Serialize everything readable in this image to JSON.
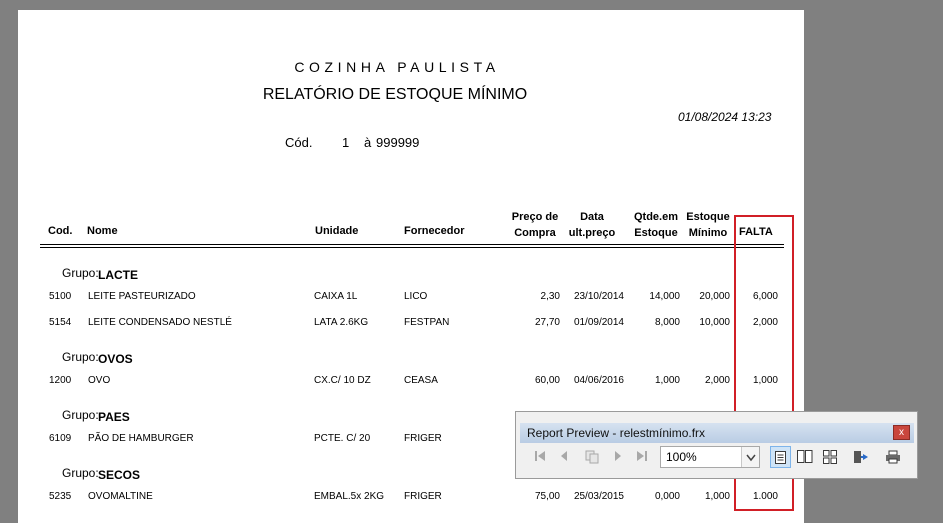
{
  "report": {
    "company": "COZINHA PAULISTA",
    "title": "RELATÓRIO DE ESTOQUE MÍNIMO",
    "datetime": "01/08/2024 13:23",
    "cod_label": "Cód.",
    "cod_from": "1",
    "cod_sep": "à",
    "cod_to": "999999"
  },
  "columns": {
    "cod": "Cod.",
    "nome": "Nome",
    "unidade": "Unidade",
    "fornecedor": "Fornecedor",
    "preco_1": "Preço de",
    "preco_2": "Compra",
    "data_1": "Data",
    "data_2": "ult.preço",
    "qtde_1": "Qtde.em",
    "qtde_2": "Estoque",
    "estmin_1": "Estoque",
    "estmin_2": "Mínimo",
    "falta": "FALTA"
  },
  "group_label": "Grupo:",
  "groups": [
    {
      "name": "LACTE",
      "rows": [
        {
          "cod": "5100",
          "nome": "LEITE PASTEURIZADO",
          "unidade": "CAIXA 1L",
          "fornecedor": "LICO",
          "preco": "2,30",
          "data": "23/10/2014",
          "qtde": "14,000",
          "estmin": "20,000",
          "falta": "6,000"
        },
        {
          "cod": "5154",
          "nome": "LEITE CONDENSADO NESTLÉ",
          "unidade": "LATA 2.6KG",
          "fornecedor": "FESTPAN",
          "preco": "27,70",
          "data": "01/09/2014",
          "qtde": "8,000",
          "estmin": "10,000",
          "falta": "2,000"
        }
      ]
    },
    {
      "name": "OVOS",
      "rows": [
        {
          "cod": "1200",
          "nome": "OVO",
          "unidade": "CX.C/ 10 DZ",
          "fornecedor": "CEASA",
          "preco": "60,00",
          "data": "04/06/2016",
          "qtde": "1,000",
          "estmin": "2,000",
          "falta": "1,000"
        }
      ]
    },
    {
      "name": "PAES",
      "rows": [
        {
          "cod": "6109",
          "nome": "PÃO DE HAMBURGER",
          "unidade": "PCTE. C/ 20",
          "fornecedor": "FRIGER"
        }
      ]
    },
    {
      "name": "SECOS",
      "rows": [
        {
          "cod": "5235",
          "nome": "OVOMALTINE",
          "unidade": "EMBAL.5x 2KG",
          "fornecedor": "FRIGER",
          "preco": "75,00",
          "data": "25/03/2015",
          "qtde": "0,000",
          "estmin": "1,000",
          "falta": "1.000"
        }
      ]
    }
  ],
  "preview": {
    "title": "Report Preview - relestmínimo.frx",
    "close": "x",
    "zoom": "100%"
  },
  "colors": {
    "highlight": "#d11f26",
    "background": "#808080"
  }
}
